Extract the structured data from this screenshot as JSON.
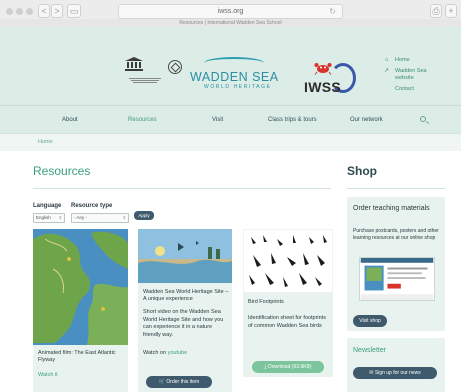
{
  "browser": {
    "url": "iwss.org",
    "tab_title": "Resources | International Wadden Sea School",
    "back_label": "<",
    "forward_label": ">",
    "reload_icon": "reload-icon"
  },
  "header": {
    "logo_title": "WADDEN SEA",
    "logo_subtitle": "WORLD HERITAGE",
    "iwss_logo": "IWSS",
    "quick_links": [
      {
        "icon": "home-icon",
        "label": "Home"
      },
      {
        "icon": "external-link-icon",
        "label": "Wadden Sea website"
      },
      {
        "icon": "",
        "label": "Contact"
      }
    ]
  },
  "nav": {
    "items": [
      "About",
      "Resources",
      "Visit",
      "Class trips & tours",
      "Our network"
    ],
    "active": "Resources"
  },
  "breadcrumb": "Home",
  "main": {
    "title": "Resources",
    "filters": {
      "language_label": "Language",
      "language_value": "English",
      "type_label": "Resource type",
      "type_value": "- Any -",
      "apply_label": "Apply"
    },
    "cards": [
      {
        "title": "Animated film: The East Atlantic Flyway",
        "link": "Watch it"
      },
      {
        "title": "Wadden Sea World Heritage Site – A unique experience",
        "text": "Short video on the Wadden Sea World Heritage Site and how you can experience it in a nature friendly way.",
        "link_prefix": "Watch on",
        "link": "youtube",
        "button": "Order this item"
      },
      {
        "title": "Bird Footprints",
        "text": "Identification sheet for footprints of common Wadden Sea birds",
        "button": "Download (93.9KB)"
      }
    ]
  },
  "sidebar": {
    "shop_title": "Shop",
    "shop_box_heading": "Order teaching materials",
    "shop_box_text": "Purchase postcards, posters and other learning resources at our online shop",
    "visit_button": "Visit shop",
    "newsletter_heading": "Newsletter",
    "signup_button": "Sign up for our news"
  },
  "colors": {
    "accent_green": "#3aa080",
    "header_bg": "#dcece7",
    "button_dark": "#3e5a6c",
    "button_green": "#7cc49b"
  }
}
